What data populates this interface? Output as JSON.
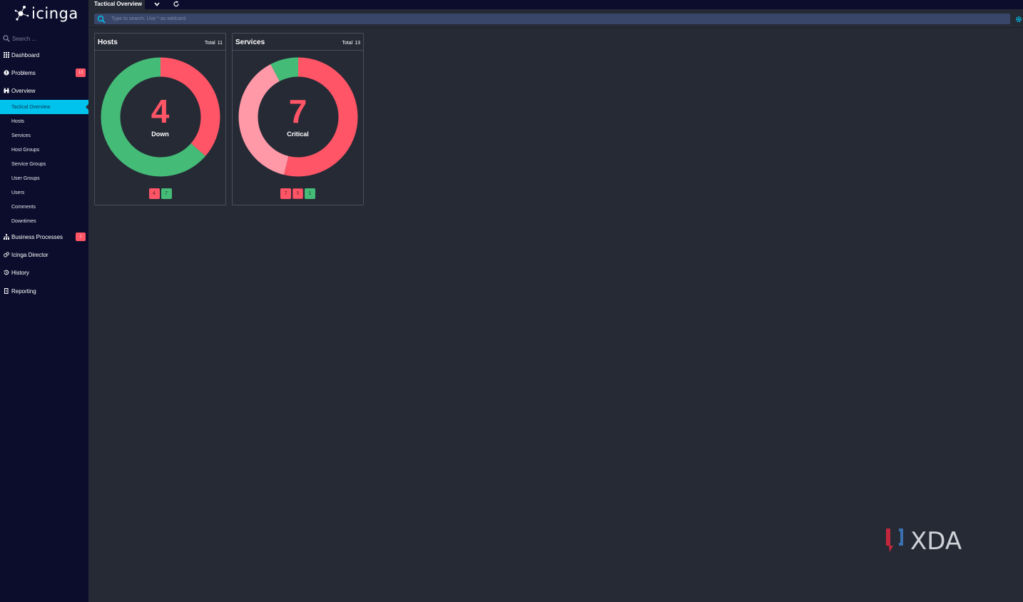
{
  "app": {
    "logo_text": "icinga"
  },
  "sidebar": {
    "search_placeholder": "Search ...",
    "items": [
      {
        "label": "Dashboard",
        "icon": "grid-icon"
      },
      {
        "label": "Problems",
        "icon": "alert-circle-icon",
        "badge": "13"
      },
      {
        "label": "Overview",
        "icon": "binoculars-icon"
      },
      {
        "label": "Business Processes",
        "icon": "sitemap-icon",
        "badge": "1"
      },
      {
        "label": "Icinga Director",
        "icon": "director-icon"
      },
      {
        "label": "History",
        "icon": "history-icon"
      },
      {
        "label": "Reporting",
        "icon": "report-icon"
      }
    ],
    "subitems": [
      {
        "label": "Tactical Overview",
        "active": true
      },
      {
        "label": "Hosts"
      },
      {
        "label": "Services"
      },
      {
        "label": "Host Groups"
      },
      {
        "label": "Service Groups"
      },
      {
        "label": "User Groups"
      },
      {
        "label": "Users"
      },
      {
        "label": "Comments"
      },
      {
        "label": "Downtimes"
      }
    ]
  },
  "topbar": {
    "active_tab": "Tactical Overview",
    "search_placeholder": "Type to search. Use * as wildcard."
  },
  "cards": {
    "hosts": {
      "title": "Hosts",
      "total_label": "Total",
      "total": "11",
      "big_number": "4",
      "big_label": "Down",
      "badges": [
        "4",
        "7"
      ]
    },
    "services": {
      "title": "Services",
      "total_label": "Total",
      "total": "13",
      "big_number": "7",
      "big_label": "Critical",
      "badges": [
        "7",
        "5",
        "1"
      ]
    }
  },
  "donuts": {
    "hosts": [
      {
        "name": "down",
        "value": 4,
        "color": "#ff5566"
      },
      {
        "name": "up",
        "value": 7,
        "color": "#44bb77"
      }
    ],
    "services": [
      {
        "name": "critical",
        "value": 7,
        "color": "#ff5566"
      },
      {
        "name": "critical-handled",
        "value": 5,
        "color": "#ff99a7"
      },
      {
        "name": "ok",
        "value": 1,
        "color": "#44bb77"
      }
    ]
  },
  "colors": {
    "accent": "#00c3ed",
    "critical": "#ff5566",
    "ok": "#44bb77",
    "sidebar_bg": "#0c0d2c",
    "main_bg": "#262a35"
  },
  "watermark": {
    "text": "XDA"
  }
}
